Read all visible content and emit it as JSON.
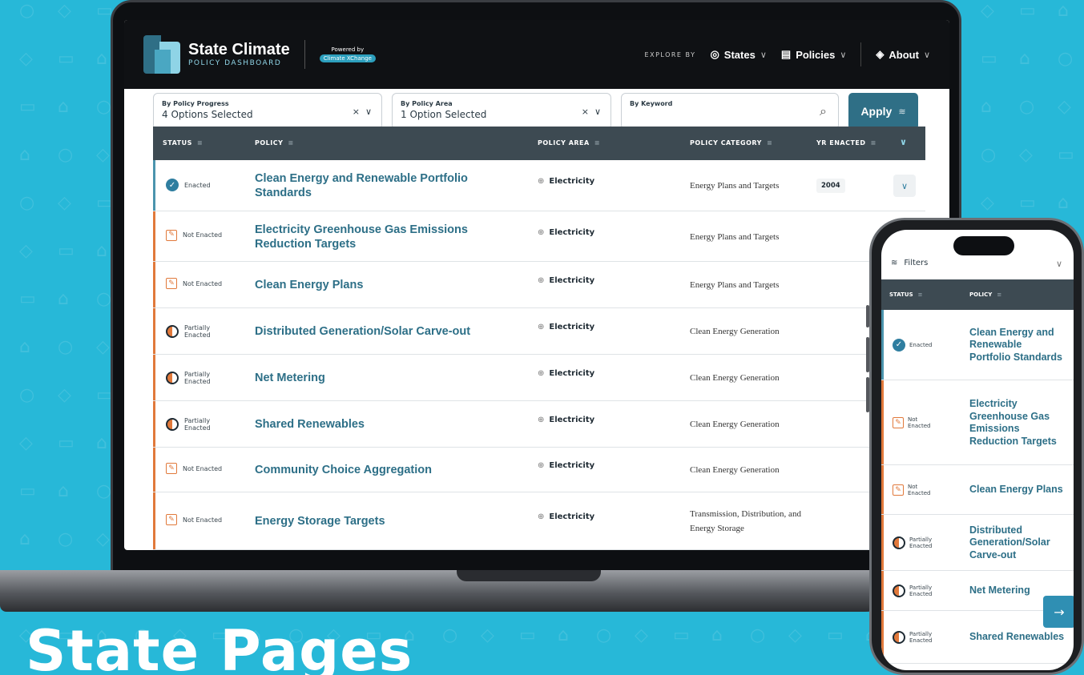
{
  "hero_title": "State Pages",
  "app": {
    "logo_title": "State Climate",
    "logo_subtitle": "POLICY DASHBOARD",
    "powered_by": "Powered by",
    "powered_by_brand": "Climate XChange",
    "explore_by": "EXPLORE BY",
    "nav": [
      {
        "label": "States",
        "icon": "location-pin-icon"
      },
      {
        "label": "Policies",
        "icon": "document-icon"
      },
      {
        "label": "About",
        "icon": "diamond-icon"
      }
    ]
  },
  "filters": {
    "progress": {
      "label": "By Policy Progress",
      "value": "4 Options Selected"
    },
    "area": {
      "label": "By Policy Area",
      "value": "1 Option Selected"
    },
    "keyword": {
      "label": "By Keyword",
      "value": ""
    },
    "apply_label": "Apply"
  },
  "table": {
    "columns": [
      "STATUS",
      "POLICY",
      "POLICY AREA",
      "POLICY CATEGORY",
      "YR ENACTED"
    ],
    "rows": [
      {
        "status": "Enacted",
        "policy": "Clean Energy and Renewable Portfolio Standards",
        "area": "Electricity",
        "category": "Energy Plans and Targets",
        "year": "2004"
      },
      {
        "status": "Not Enacted",
        "policy": "Electricity Greenhouse Gas Emissions Reduction Targets",
        "area": "Electricity",
        "category": "Energy Plans and Targets",
        "year": ""
      },
      {
        "status": "Not Enacted",
        "policy": "Clean Energy Plans",
        "area": "Electricity",
        "category": "Energy Plans and Targets",
        "year": ""
      },
      {
        "status": "Partially Enacted",
        "policy": "Distributed Generation/Solar Carve-out",
        "area": "Electricity",
        "category": "Clean Energy Generation",
        "year": ""
      },
      {
        "status": "Partially Enacted",
        "policy": "Net Metering",
        "area": "Electricity",
        "category": "Clean Energy Generation",
        "year": ""
      },
      {
        "status": "Partially Enacted",
        "policy": "Shared Renewables",
        "area": "Electricity",
        "category": "Clean Energy Generation",
        "year": ""
      },
      {
        "status": "Not Enacted",
        "policy": "Community Choice Aggregation",
        "area": "Electricity",
        "category": "Clean Energy Generation",
        "year": ""
      },
      {
        "status": "Not Enacted",
        "policy": "Energy Storage Targets",
        "area": "Electricity",
        "category": "Transmission, Distribution, and Energy Storage",
        "year": ""
      }
    ]
  },
  "mobile": {
    "filters_label": "Filters",
    "columns": [
      "STATUS",
      "POLICY"
    ],
    "rows": [
      {
        "status": "Enacted",
        "policy": "Clean Energy and Renewable Portfolio Standards"
      },
      {
        "status": "Not Enacted",
        "policy": "Electricity Greenhouse Gas Emissions Reduction Targets"
      },
      {
        "status": "Not Enacted",
        "policy": "Clean Energy Plans"
      },
      {
        "status": "Partially Enacted",
        "policy": "Distributed Generation/Solar Carve-out"
      },
      {
        "status": "Partially Enacted",
        "policy": "Net Metering"
      },
      {
        "status": "Partially Enacted",
        "policy": "Shared Renewables"
      }
    ]
  },
  "colors": {
    "background": "#27b8d8",
    "accent": "#2f6f86",
    "not_enacted": "#e1793b",
    "enacted": "#2f7ea0"
  }
}
